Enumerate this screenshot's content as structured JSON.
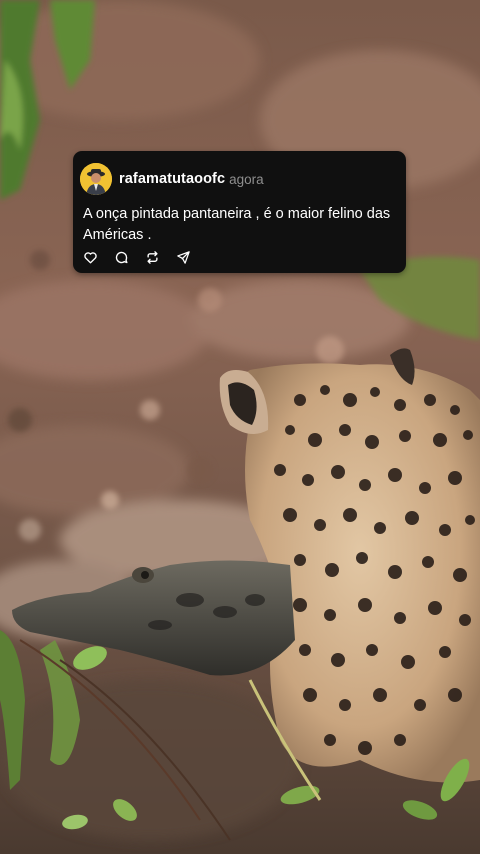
{
  "post": {
    "username": "rafamatutaoofc",
    "timestamp": "agora",
    "text": "A onça pintada pantaneira , é o maior felino das Américas ."
  },
  "actions": [
    {
      "icon": "heart-icon"
    },
    {
      "icon": "comment-icon"
    },
    {
      "icon": "repost-icon"
    },
    {
      "icon": "share-icon"
    }
  ],
  "background": {
    "subject": "jaguar-holding-caiman"
  }
}
